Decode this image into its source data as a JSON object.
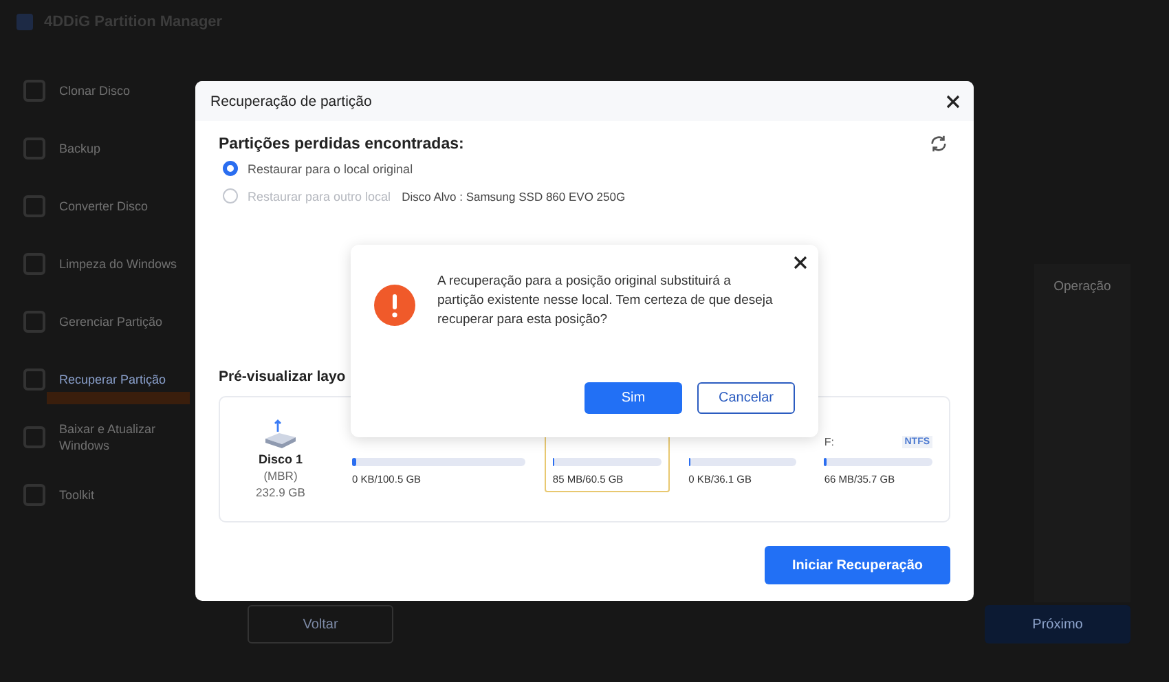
{
  "app": {
    "title": "4DDiG Partition Manager"
  },
  "sidebar": {
    "items": [
      {
        "label": "Clonar Disco",
        "selected": false
      },
      {
        "label": "Backup",
        "selected": false
      },
      {
        "label": "Converter Disco",
        "selected": false
      },
      {
        "label": "Limpeza do Windows",
        "selected": false
      },
      {
        "label": "Gerenciar Partição",
        "selected": false
      },
      {
        "label": "Recuperar Partição",
        "selected": true
      },
      {
        "label": "Baixar e Atualizar Windows",
        "selected": false
      },
      {
        "label": "Toolkit",
        "selected": false
      }
    ]
  },
  "table": {
    "columns": [
      "Operação"
    ]
  },
  "footer_buttons": [
    "Voltar",
    "Próximo"
  ],
  "dialog": {
    "title": "Recuperação de partição",
    "heading": "Partições perdidas encontradas:",
    "options": [
      {
        "label": "Restaurar para o local original",
        "selected": true,
        "disabled": false
      },
      {
        "label": "Restaurar para outro local",
        "selected": false,
        "disabled": true,
        "detail": "Disco Alvo : Samsung SSD 860 EVO 250G"
      }
    ],
    "preview_heading": "Pré-visualizar layo",
    "disk": {
      "name": "Disco 1",
      "type": "(MBR)",
      "size": "232.9 GB"
    },
    "partitions": [
      {
        "usage": "0 KB/100.5 GB",
        "level": 0.02,
        "selected": false
      },
      {
        "usage": "85 MB/60.5 GB",
        "level": 0.02,
        "selected": true
      },
      {
        "usage": "0 KB/36.1 GB",
        "level": 0.02,
        "selected": false
      },
      {
        "label": "F:",
        "fs": "NTFS",
        "usage": "66 MB/35.7 GB",
        "level": 0.02,
        "selected": false
      }
    ],
    "action": "Iniciar Recuperação"
  },
  "confirm": {
    "message": "A recuperação para a posição original substituirá a partição existente nesse local. Tem certeza de que deseja recuperar para esta posição?",
    "buttons": [
      {
        "label": "Sim",
        "kind": "primary"
      },
      {
        "label": "Cancelar",
        "kind": "secondary"
      }
    ]
  }
}
